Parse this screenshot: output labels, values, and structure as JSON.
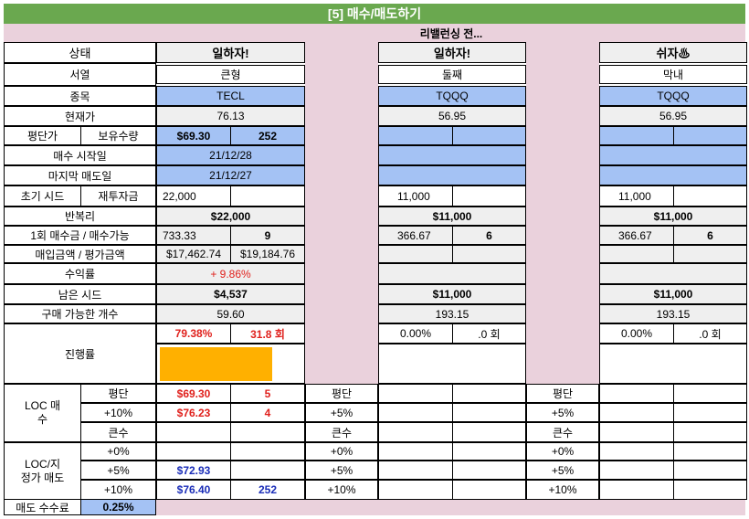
{
  "title": "[5] 매수/매도하기",
  "rebalance_note": "리밸런싱 전...",
  "labels": {
    "status": "상태",
    "order": "서열",
    "ticker": "종목",
    "current_price": "현재가",
    "avg_price": "평단가",
    "holding_qty": "보유수량",
    "buy_start": "매수 시작일",
    "last_sell": "마지막 매도일",
    "initial_seed": "초기 시드",
    "reinvest": "재투자금",
    "compound": "반복리",
    "per_buy": "1회 매수금 / 매수가능",
    "buy_eval": "매입금액 / 평가금액",
    "profit": "수익률",
    "remaining_seed": "남은 시드",
    "buyable_count": "구매 가능한 개수",
    "progress": "진행률",
    "loc_buy": "LOC 매수",
    "loc_sell": "LOC/지정가 매도",
    "avg": "평단",
    "plus10": "+10%",
    "plus5": "+5%",
    "plus0": "+0%",
    "big": "큰수",
    "sell_fee": "매도 수수료"
  },
  "sell_fee_value": "0.25%",
  "slots": [
    {
      "status": "일하자!",
      "order": "큰형",
      "ticker": "TECL",
      "current_price": "76.13",
      "avg_price": "$69.30",
      "holding_qty": "252",
      "buy_start": "21/12/28",
      "last_sell": "21/12/27",
      "initial_seed": "22,000",
      "reinvest": "",
      "compound": "$22,000",
      "per_buy": "733.33",
      "buyable": "9",
      "buy_amount": "$17,462.74",
      "eval_amount": "$19,184.76",
      "profit": "+ 9.86%",
      "remaining_seed": "$4,537",
      "buyable_count": "59.60",
      "progress_pct": "79.38%",
      "progress_rounds": "31.8 회",
      "progress_fraction": 0.7938,
      "loc_avg_price": "$69.30",
      "loc_avg_qty": "5",
      "loc_10_price": "$76.23",
      "loc_10_qty": "4",
      "sell_5_price": "$72.93",
      "sell_10_price": "$76.40",
      "sell_10_qty": "252"
    },
    {
      "status": "일하자!",
      "order": "둘째",
      "ticker": "TQQQ",
      "current_price": "56.95",
      "initial_seed": "11,000",
      "compound": "$11,000",
      "per_buy": "366.67",
      "buyable": "6",
      "remaining_seed": "$11,000",
      "buyable_count": "193.15",
      "progress_pct": "0.00%",
      "progress_rounds": ".0 회"
    },
    {
      "status": "쉬자♨",
      "order": "막내",
      "ticker": "TQQQ",
      "current_price": "56.95",
      "initial_seed": "11,000",
      "compound": "$11,000",
      "per_buy": "366.67",
      "buyable": "6",
      "remaining_seed": "$11,000",
      "buyable_count": "193.15",
      "progress_pct": "0.00%",
      "progress_rounds": ".0 회"
    }
  ]
}
